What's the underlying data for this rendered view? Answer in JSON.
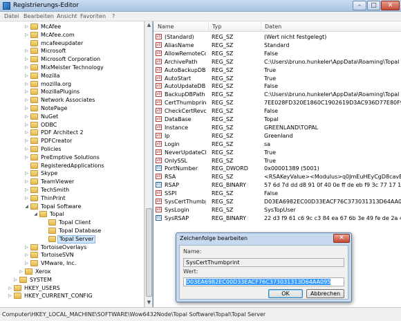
{
  "window": {
    "title": "Registrierungs-Editor",
    "min": "–",
    "max": "□",
    "close": "✕"
  },
  "menu": [
    "Datei",
    "Bearbeiten",
    "Ansicht",
    "Favoriten",
    "?"
  ],
  "tree": [
    {
      "label": "McAfee",
      "level": 3,
      "exp": "▷"
    },
    {
      "label": "McAfee.com",
      "level": 3,
      "exp": "▷"
    },
    {
      "label": "mcafeeupdater",
      "level": 3,
      "exp": ""
    },
    {
      "label": "Microsoft",
      "level": 3,
      "exp": "▷"
    },
    {
      "label": "Microsoft Corporation",
      "level": 3,
      "exp": "▷"
    },
    {
      "label": "MixMeister Technology",
      "level": 3,
      "exp": "▷"
    },
    {
      "label": "Mozilla",
      "level": 3,
      "exp": "▷"
    },
    {
      "label": "mozilla.org",
      "level": 3,
      "exp": "▷"
    },
    {
      "label": "MozillaPlugins",
      "level": 3,
      "exp": "▷"
    },
    {
      "label": "Network Associates",
      "level": 3,
      "exp": "▷"
    },
    {
      "label": "NotePage",
      "level": 3,
      "exp": "▷"
    },
    {
      "label": "NuGet",
      "level": 3,
      "exp": "▷"
    },
    {
      "label": "ODBC",
      "level": 3,
      "exp": "▷"
    },
    {
      "label": "PDF Architect 2",
      "level": 3,
      "exp": "▷"
    },
    {
      "label": "PDFCreator",
      "level": 3,
      "exp": "▷"
    },
    {
      "label": "Policies",
      "level": 3,
      "exp": "▷"
    },
    {
      "label": "PreEmptive Solutions",
      "level": 3,
      "exp": "▷"
    },
    {
      "label": "RegisteredApplications",
      "level": 3,
      "exp": ""
    },
    {
      "label": "Skype",
      "level": 3,
      "exp": "▷"
    },
    {
      "label": "TeamViewer",
      "level": 3,
      "exp": "▷"
    },
    {
      "label": "TechSmith",
      "level": 3,
      "exp": "▷"
    },
    {
      "label": "ThinPrint",
      "level": 3,
      "exp": "▷"
    },
    {
      "label": "Topal Software",
      "level": 3,
      "exp": "◢"
    },
    {
      "label": "Topal",
      "level": 4,
      "exp": "◢"
    },
    {
      "label": "Topal Client",
      "level": 5,
      "exp": ""
    },
    {
      "label": "Topal Database",
      "level": 5,
      "exp": ""
    },
    {
      "label": "Topal Server",
      "level": 5,
      "exp": "",
      "selected": true
    },
    {
      "label": "TortoiseOverlays",
      "level": 3,
      "exp": "▷"
    },
    {
      "label": "TortoiseSVN",
      "level": 3,
      "exp": "▷"
    },
    {
      "label": "VMware, Inc.",
      "level": 3,
      "exp": "▷"
    },
    {
      "label": "Xerox",
      "level": 2,
      "exp": "▷"
    },
    {
      "label": "SYSTEM",
      "level": 1,
      "exp": "▷"
    },
    {
      "label": "HKEY_USERS",
      "level": 0,
      "exp": "▷"
    },
    {
      "label": "HKEY_CURRENT_CONFIG",
      "level": 0,
      "exp": "▷"
    }
  ],
  "columns": [
    "Name",
    "Typ",
    "Daten"
  ],
  "values": [
    {
      "name": "(Standard)",
      "type": "REG_SZ",
      "data": "(Wert nicht festgelegt)",
      "icon": "ab"
    },
    {
      "name": "AliasName",
      "type": "REG_SZ",
      "data": "Standard",
      "icon": "ab"
    },
    {
      "name": "AllowRemoteCo...",
      "type": "REG_SZ",
      "data": "False",
      "icon": "ab"
    },
    {
      "name": "ArchivePath",
      "type": "REG_SZ",
      "data": "C:\\Users\\bruno.hunkeler\\AppData\\Roaming\\Topal",
      "icon": "ab"
    },
    {
      "name": "AutoBackupDB",
      "type": "REG_SZ",
      "data": "True",
      "icon": "ab"
    },
    {
      "name": "AutoStart",
      "type": "REG_SZ",
      "data": "True",
      "icon": "ab"
    },
    {
      "name": "AutoUpdateDB",
      "type": "REG_SZ",
      "data": "False",
      "icon": "ab"
    },
    {
      "name": "BackupDBPath",
      "type": "REG_SZ",
      "data": "C:\\Users\\bruno.hunkeler\\AppData\\Roaming\\Topal",
      "icon": "ab"
    },
    {
      "name": "CertThumbprint",
      "type": "REG_SZ",
      "data": "7EE028FD320E1860C1902619D3AC936D77E80F9",
      "icon": "ab"
    },
    {
      "name": "CheckCertRevoc...",
      "type": "REG_SZ",
      "data": "False",
      "icon": "ab"
    },
    {
      "name": "DataBase",
      "type": "REG_SZ",
      "data": "Topal",
      "icon": "ab"
    },
    {
      "name": "Instance",
      "type": "REG_SZ",
      "data": "GREENLAND\\TOPAL",
      "icon": "ab"
    },
    {
      "name": "Ip",
      "type": "REG_SZ",
      "data": "Greenland",
      "icon": "ab"
    },
    {
      "name": "Login",
      "type": "REG_SZ",
      "data": "sa",
      "icon": "ab"
    },
    {
      "name": "NeverUpdateCli...",
      "type": "REG_SZ",
      "data": "True",
      "icon": "ab"
    },
    {
      "name": "OnlySSL",
      "type": "REG_SZ",
      "data": "True",
      "icon": "ab"
    },
    {
      "name": "PortNumber",
      "type": "REG_DWORD",
      "data": "0x00001389 (5001)",
      "icon": "bin"
    },
    {
      "name": "RSA",
      "type": "REG_SZ",
      "data": "<RSAKeyValue><Modulus>q0JmEuHEyCgD8cavE...",
      "icon": "ab"
    },
    {
      "name": "RSAP",
      "type": "REG_BINARY",
      "data": "57 6d 7d dd d8 91 0f 40 0e ff de eb f9 3c 77 17 18 71...",
      "icon": "bin"
    },
    {
      "name": "SSPI",
      "type": "REG_SZ",
      "data": "False",
      "icon": "ab"
    },
    {
      "name": "SysCertThumbp...",
      "type": "REG_SZ",
      "data": "D03EA6982EC00D33EACF76C373031313D64AA095",
      "icon": "ab"
    },
    {
      "name": "SysLogin",
      "type": "REG_SZ",
      "data": "SysTopUser",
      "icon": "ab"
    },
    {
      "name": "SysRSAP",
      "type": "REG_BINARY",
      "data": "22 d3 f9 61 c6 9c c3 84 ea 67 6b 3e 49 fe de 2a 4e de...",
      "icon": "bin"
    }
  ],
  "status": "Computer\\HKEY_LOCAL_MACHINE\\SOFTWARE\\Wow6432Node\\Topal Software\\Topal\\Topal Server",
  "dialog": {
    "title": "Zeichenfolge bearbeiten",
    "name_label": "Name:",
    "name_value": "SysCertThumbprint",
    "value_label": "Wert:",
    "value_value": "D03EA6982EC00D33EACF76C373031313D64AA095",
    "ok": "OK",
    "cancel": "Abbrechen"
  }
}
